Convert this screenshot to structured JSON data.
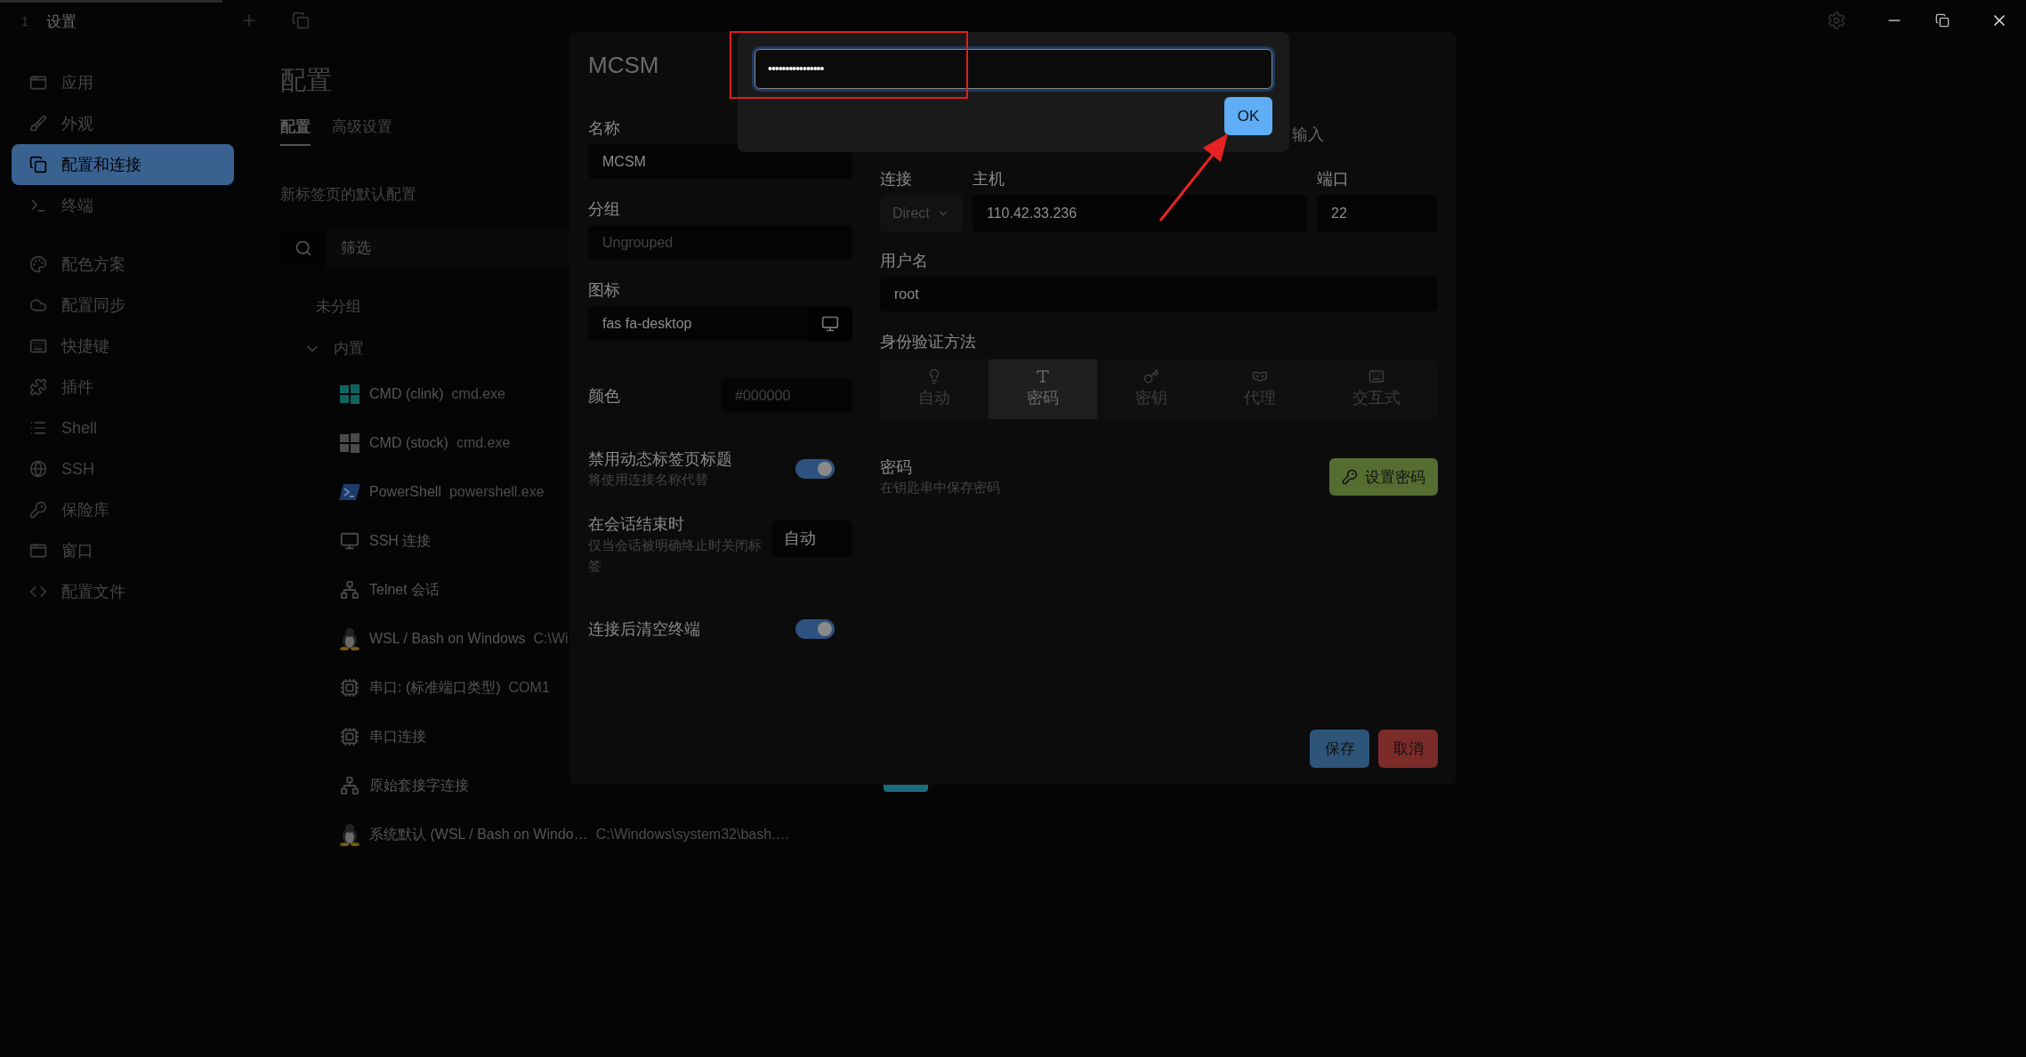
{
  "title_bar": {
    "tab_number": "1",
    "tab_title": "设置"
  },
  "sidebar": {
    "sections": [
      {
        "items": [
          {
            "label": "应用",
            "selected": false
          },
          {
            "label": "外观",
            "selected": false
          },
          {
            "label": "配置和连接",
            "selected": true
          },
          {
            "label": "终端",
            "selected": false
          }
        ]
      },
      {
        "items": [
          {
            "label": "配色方案",
            "selected": false
          },
          {
            "label": "配置同步",
            "selected": false
          },
          {
            "label": "快捷键",
            "selected": false
          },
          {
            "label": "插件",
            "selected": false
          },
          {
            "label": "Shell",
            "selected": false
          },
          {
            "label": "SSH",
            "selected": false
          },
          {
            "label": "保险库",
            "selected": false
          },
          {
            "label": "窗口",
            "selected": false
          },
          {
            "label": "配置文件",
            "selected": false
          }
        ]
      }
    ]
  },
  "page": {
    "title": "配置",
    "tabs": [
      {
        "label": "配置",
        "selected": true
      },
      {
        "label": "高级设置",
        "selected": false
      }
    ],
    "section_title": "新标签页的默认配置",
    "search": {
      "placeholder": "筛选"
    },
    "groups": [
      {
        "label": "未分组"
      },
      {
        "label": "内置",
        "expanded": true,
        "children": [
          {
            "name": "CMD (clink)",
            "command": "cmd.exe"
          },
          {
            "name": "CMD (stock)",
            "command": "cmd.exe"
          },
          {
            "name": "PowerShell",
            "command": "powershell.exe"
          },
          {
            "name": "SSH 连接"
          },
          {
            "name": "Telnet 会话"
          },
          {
            "name": "WSL / Bash on Windows",
            "command": "C:\\Wi"
          },
          {
            "name": "串口: (标准端口类型)",
            "command": "COM1"
          },
          {
            "name": "串口连接"
          },
          {
            "name": "原始套接字连接"
          },
          {
            "name": "系统默认 (WSL / Bash on Windo…",
            "command": "C:\\Windows\\system32\\bash.…"
          }
        ]
      }
    ]
  },
  "dialog": {
    "title": "MCSM",
    "name": {
      "label": "名称",
      "value": "MCSM"
    },
    "group": {
      "label": "分组",
      "placeholder": "Ungrouped"
    },
    "icon": {
      "label": "图标",
      "value": "fas fa-desktop"
    },
    "color": {
      "label": "颜色",
      "placeholder": "#000000"
    },
    "disable_dynamic_title": {
      "label": "禁用动态标签页标题",
      "description": "将使用连接名称代替",
      "on": true
    },
    "on_session_end": {
      "label": "在会话结束时",
      "description": "仅当会话被明确终止时关闭标签",
      "value": "自动"
    },
    "clear_on_connect": {
      "label": "连接后清空终端",
      "on": true
    },
    "visible_tab": {
      "label": "输入"
    },
    "connection": {
      "label": "连接",
      "value": "Direct",
      "disabled": true
    },
    "host": {
      "label": "主机",
      "value": "110.42.33.236"
    },
    "port": {
      "label": "端口",
      "value": "22"
    },
    "username": {
      "label": "用户名",
      "value": "root"
    },
    "auth": {
      "label": "身份验证方法",
      "options": [
        {
          "label": "自动",
          "selected": false
        },
        {
          "label": "密码",
          "selected": true
        },
        {
          "label": "密钥",
          "selected": false
        },
        {
          "label": "代理",
          "selected": false
        },
        {
          "label": "交互式",
          "selected": false
        }
      ]
    },
    "password": {
      "label": "密码",
      "description": "在钥匙串中保存密码",
      "button": "设置密码"
    },
    "buttons": [
      {
        "label": "保存",
        "kind": "save"
      },
      {
        "label": "取消",
        "kind": "cancel"
      }
    ]
  },
  "prompt": {
    "value": "••••••••••••••••",
    "button": "OK"
  }
}
